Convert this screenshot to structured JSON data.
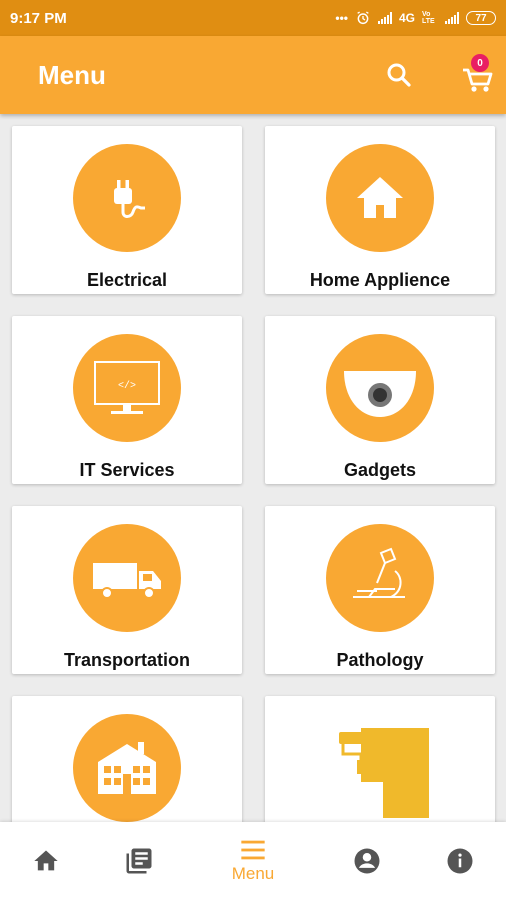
{
  "status_bar": {
    "time": "9:17 PM",
    "network": "4G",
    "volte": "Vo LTE",
    "battery": "77"
  },
  "app_bar": {
    "title": "Menu",
    "search_icon": "search-icon",
    "cart_icon": "cart-icon",
    "cart_count": "0"
  },
  "categories": [
    {
      "label": "Electrical",
      "icon": "plug-icon"
    },
    {
      "label": "Home Applience",
      "icon": "house-icon"
    },
    {
      "label": "IT Services",
      "icon": "monitor-code-icon"
    },
    {
      "label": "Gadgets",
      "icon": "security-camera-icon"
    },
    {
      "label": "Transportation",
      "icon": "truck-icon"
    },
    {
      "label": "Pathology",
      "icon": "microscope-icon"
    },
    {
      "label": "",
      "icon": "building-icon"
    },
    {
      "label": "",
      "icon": "paint-roller-icon"
    }
  ],
  "bottom_nav": {
    "items": [
      {
        "icon": "home-icon",
        "label": ""
      },
      {
        "icon": "list-icon",
        "label": ""
      },
      {
        "icon": "menu-icon",
        "label": "Menu",
        "active": true
      },
      {
        "icon": "account-icon",
        "label": ""
      },
      {
        "icon": "info-icon",
        "label": ""
      }
    ]
  },
  "colors": {
    "status_bar": "#e08e12",
    "accent": "#f9a833",
    "badge": "#e91e63",
    "nav_icon": "#555555"
  }
}
